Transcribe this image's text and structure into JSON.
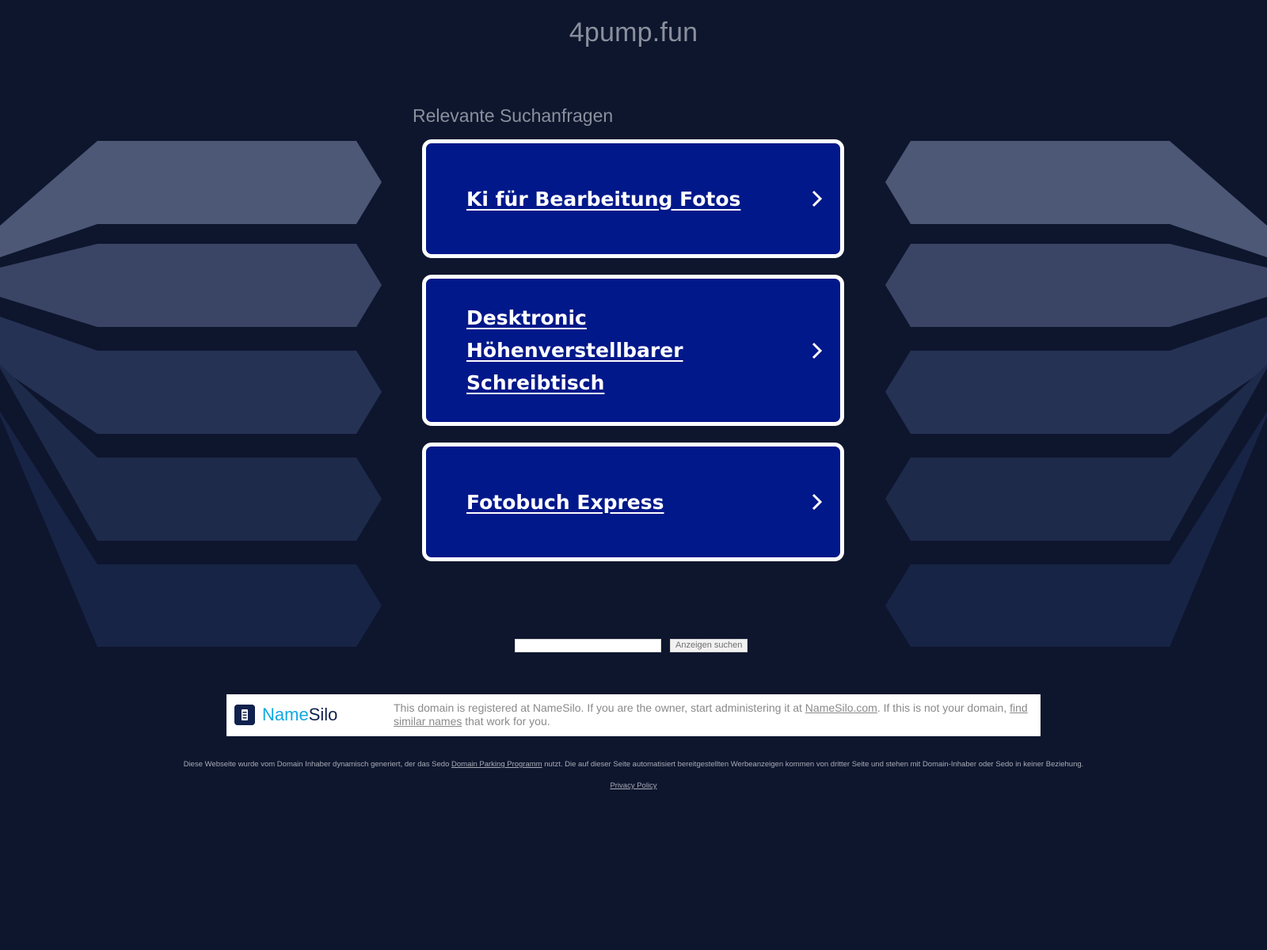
{
  "header": {
    "domain": "4pump.fun"
  },
  "related": {
    "heading": "Relevante Suchanfragen",
    "links": [
      {
        "label": "Ki für Bearbeitung Fotos"
      },
      {
        "label": "Desktronic Höhenverstellbarer Schreibtisch"
      },
      {
        "label": "Fotobuch Express"
      }
    ]
  },
  "search": {
    "input_value": "",
    "button_label": "Anzeigen suchen"
  },
  "registrar": {
    "logo_name": "Name",
    "logo_silo": "Silo",
    "text_1": "This domain is registered at NameSilo. If you are the owner, start administering it at ",
    "link_1": "NameSilo.com",
    "text_2": ". If this is not your domain, ",
    "link_2": "find similar names",
    "text_3": " that work for you."
  },
  "footer": {
    "disclaimer_1": "Diese Webseite wurde vom Domain Inhaber dynamisch generiert, der das Sedo ",
    "disclaimer_link": "Domain Parking Programm",
    "disclaimer_2": " nutzt. Die auf dieser Seite automatisiert bereitgestellten Werbeanzeigen kommen von dritter Seite und stehen mit Domain-Inhaber oder Sedo in keiner Beziehung.",
    "privacy_label": "Privacy Policy"
  },
  "colors": {
    "background": "#0e162e",
    "card_fill": "#01188a",
    "card_border": "#ffffff",
    "namesilo_blue": "#12a9e1",
    "namesilo_navy": "#10214d"
  },
  "icons": {
    "card_arrow": "chevron-right-icon",
    "registrar_logo": "namesilo-logo-icon"
  }
}
